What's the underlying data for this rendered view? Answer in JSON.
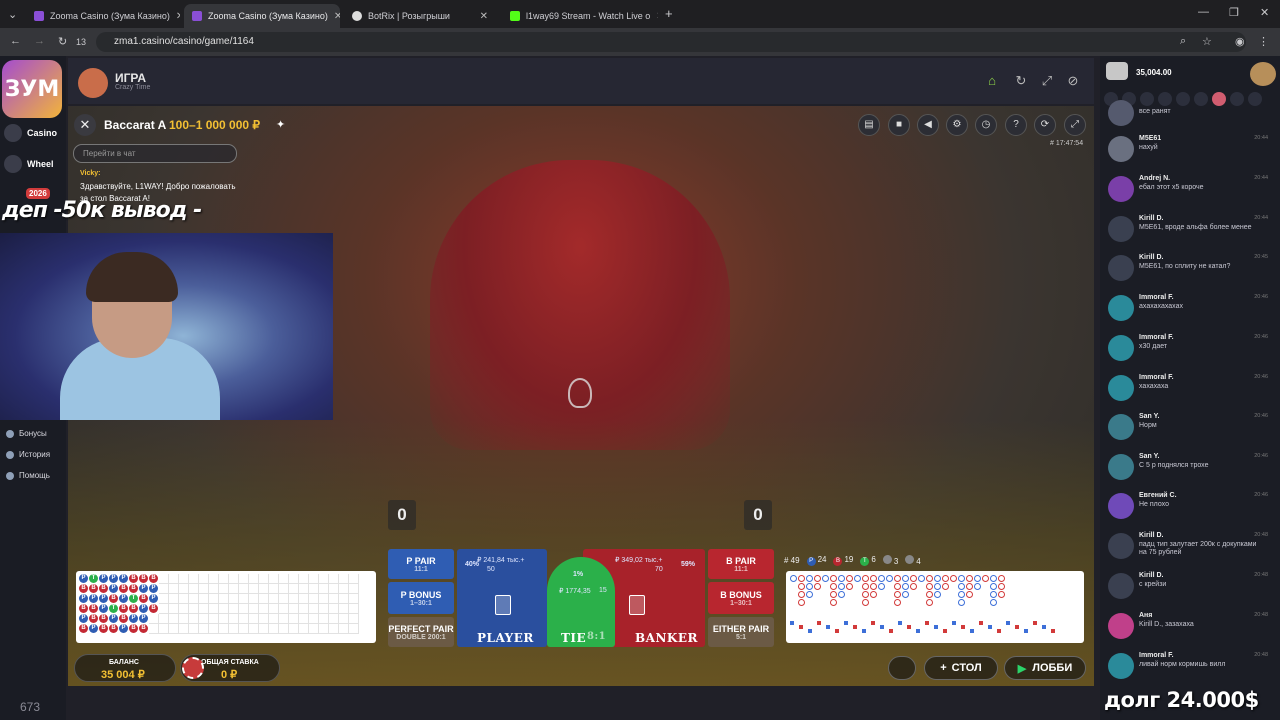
{
  "browser": {
    "tabs": [
      {
        "title": "Zooma Casino (Зума Казино)",
        "active": false,
        "favicon_color": "#8a4fd6"
      },
      {
        "title": "Zooma Casino (Зума Казино)",
        "active": true,
        "favicon_color": "#8a4fd6"
      },
      {
        "title": "BotRix | Розыгрыши",
        "active": false,
        "favicon_color": "#dddddd"
      },
      {
        "title": "l1way69 Stream - Watch Live o",
        "active": false,
        "favicon_color": "#53fc18"
      }
    ],
    "new_tab": "+",
    "url": "zma1.casino/casino/game/1164",
    "nav_count": "13"
  },
  "sidebar": {
    "logo_text": "ЗУМ",
    "casino_label": "Casino",
    "wheel_label": "Wheel",
    "event_badge": "2026",
    "bonuses": "Бонусы",
    "history": "История",
    "help": "Помощь"
  },
  "game_header": {
    "title": "ИГРА",
    "subtitle": "Crazy Time"
  },
  "table": {
    "name": "Baccarat A",
    "limits": "100–1 000 000 ₽",
    "game_id": "# 17:47:54",
    "chat_placeholder": "Перейти в чат",
    "chat_author": "Vicky:",
    "chat_text": "Здравствуйте, L1WAY! Добро пожаловать за стол Baccarat A!",
    "player_score": "0",
    "banker_score": "0"
  },
  "roadmap_stats": {
    "total": "# 49",
    "player": "24",
    "banker": "19",
    "tie": "6",
    "player_pair": "3",
    "banker_pair": "4"
  },
  "bets": {
    "p_pair": {
      "label": "P PAIR",
      "payout": "11:1"
    },
    "p_bonus": {
      "label": "P BONUS",
      "payout": "1–30:1"
    },
    "perfect_pair": {
      "label": "PERFECT PAIR",
      "payout": "DOUBLE 200:1"
    },
    "player": {
      "label": "PLAYER",
      "amount": "₽ 241,84 тыс.+",
      "players": "50",
      "pct": "40%"
    },
    "tie": {
      "label": "TIE",
      "payout": "8:1",
      "amount": "₽ 1774,35",
      "players": "15",
      "pct": "1%"
    },
    "banker": {
      "label": "BANKER",
      "amount": "₽ 349,02 тыс.+",
      "players": "70",
      "pct": "59%"
    },
    "b_pair": {
      "label": "B PAIR",
      "payout": "11:1"
    },
    "b_bonus": {
      "label": "B BONUS",
      "payout": "1–30:1"
    },
    "either_pair": {
      "label": "EITHER PAIR",
      "payout": "5:1"
    }
  },
  "footer": {
    "balance_label": "БАЛАНС",
    "balance_value": "35 004 ₽",
    "total_bet_label": "ОБЩАЯ СТАВКА",
    "total_bet_value": "0 ₽",
    "table_button": "СТОЛ",
    "lobby_button": "ЛОББИ"
  },
  "stream": {
    "overlay_top": "деп -50к вывод -",
    "overlay_bottom": "долг 24.000$",
    "viewers": "673"
  },
  "right_panel": {
    "balance": "35,004.00",
    "messages": [
      {
        "name": "",
        "text": "все ранят",
        "time": "",
        "color": "#555a6e"
      },
      {
        "name": "M5E61",
        "text": "нахуй",
        "time": "20:44",
        "color": "#6a7080"
      },
      {
        "name": "Andrej N.",
        "text": "ебал этот x5 короче",
        "time": "20:44",
        "color": "#7a3fa8"
      },
      {
        "name": "Kirill D.",
        "text": "M5E61, вроде альфа более менее",
        "time": "20:44",
        "color": "#3a4050"
      },
      {
        "name": "Kirill D.",
        "text": "M5E61, по сплиту не катал?",
        "time": "20:45",
        "color": "#3a4050"
      },
      {
        "name": "Immoral F.",
        "text": "ахахахахахах",
        "time": "20:46",
        "color": "#2a8a9a"
      },
      {
        "name": "Immoral F.",
        "text": "х30 дает",
        "time": "20:46",
        "color": "#2a8a9a"
      },
      {
        "name": "Immoral F.",
        "text": "хахахаха",
        "time": "20:46",
        "color": "#2a8a9a"
      },
      {
        "name": "San Y.",
        "text": "Норм",
        "time": "20:46",
        "color": "#3a7a8a"
      },
      {
        "name": "San Y.",
        "text": "С 5 р поднялся трохе",
        "time": "20:46",
        "color": "#3a7a8a"
      },
      {
        "name": "Евгений С.",
        "text": "Не плохо",
        "time": "20:46",
        "color": "#6f4ab8"
      },
      {
        "name": "Kirill D.",
        "text": "падц тип залутает 200к с докупками на 75 рублей",
        "time": "20:48",
        "color": "#3a4050"
      },
      {
        "name": "Kirill D.",
        "text": "с крейзи",
        "time": "20:48",
        "color": "#3a4050"
      },
      {
        "name": "Аня",
        "text": "Kirill D., зазахаха",
        "time": "20:48",
        "color": "#c0408a"
      },
      {
        "name": "Immoral F.",
        "text": "ливай норм кормишь вилл",
        "time": "20:48",
        "color": "#2a8a9a"
      }
    ]
  },
  "colors": {
    "accent": "#f3c033",
    "player_blue": "#2a4f9e",
    "banker_red": "#a8222a",
    "tie_green": "#2bb04a"
  }
}
